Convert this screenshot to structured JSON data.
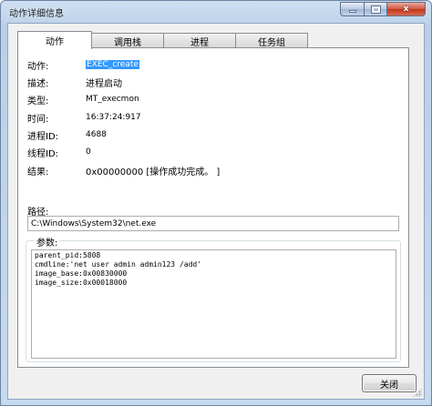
{
  "window": {
    "title": "动作详细信息",
    "close_glyph": "x"
  },
  "tabs": [
    {
      "label": "动作",
      "active": true
    },
    {
      "label": "调用栈",
      "active": false
    },
    {
      "label": "进程",
      "active": false
    },
    {
      "label": "任务组",
      "active": false
    }
  ],
  "fields": [
    {
      "label": "动作:",
      "value": "EXEC_create"
    },
    {
      "label": "描述:",
      "value": "进程启动"
    },
    {
      "label": "类型:",
      "value": "MT_execmon"
    },
    {
      "label": "时间:",
      "value": "16:37:24:917"
    },
    {
      "label": "进程ID:",
      "value": "4688"
    },
    {
      "label": "线程ID:",
      "value": "0"
    },
    {
      "label": "结果:",
      "value": "0x00000000 [操作成功完成。 ]"
    }
  ],
  "path": {
    "label": "路径:",
    "value": "C:\\Windows\\System32\\net.exe"
  },
  "params": {
    "label": "参数:",
    "lines": [
      "parent_pid:5808",
      "cmdline:'net user admin admin123 /add'",
      "image_base:0x00830000",
      "image_size:0x00018000"
    ]
  },
  "buttons": {
    "close_label": "关闭"
  }
}
